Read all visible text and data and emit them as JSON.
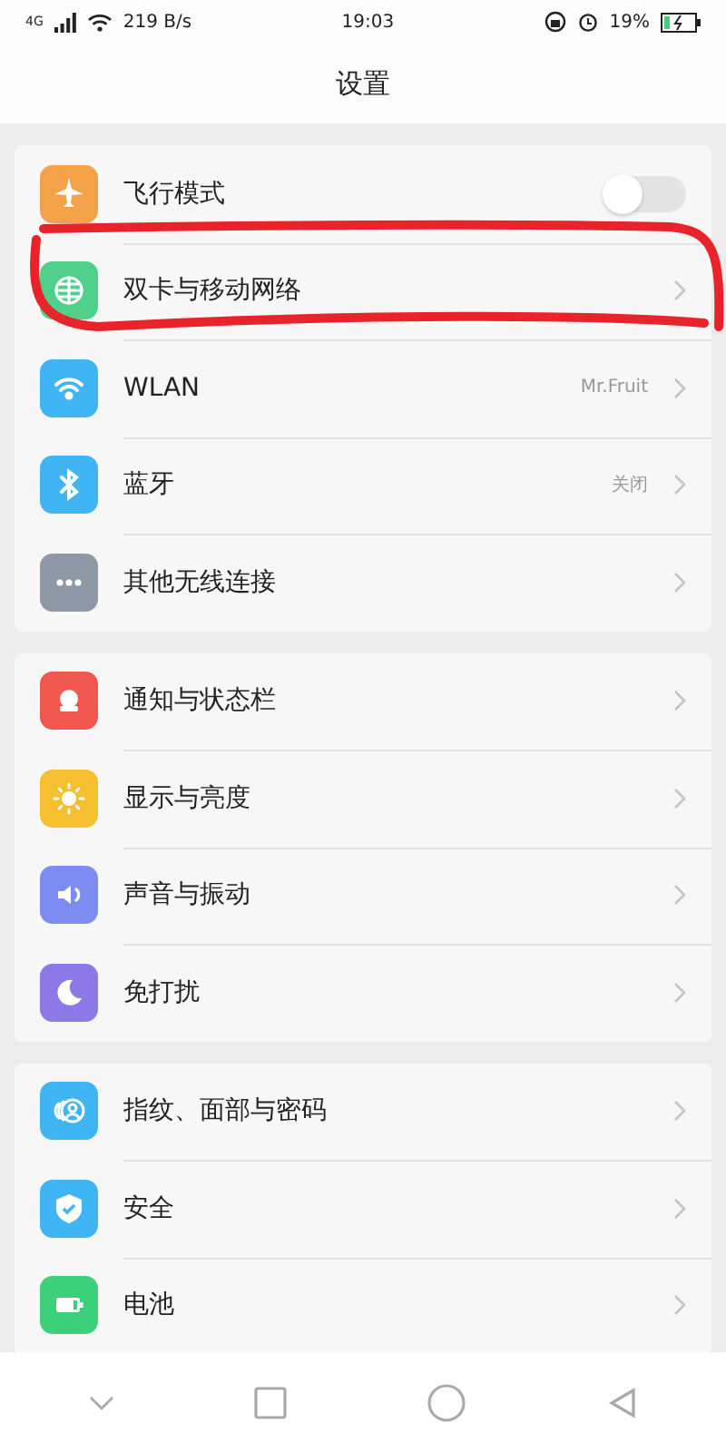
{
  "status_bar": {
    "network": "4G",
    "speed": "219 B/s",
    "time": "19:03",
    "battery": "19%"
  },
  "title": "设置",
  "groups": [
    {
      "items": [
        {
          "label": "飞行模式",
          "kind": "toggle",
          "on": false
        },
        {
          "label": "双卡与移动网络",
          "kind": "link"
        },
        {
          "label": "WLAN",
          "kind": "link",
          "value": "Mr.Fruit"
        },
        {
          "label": "蓝牙",
          "kind": "link",
          "value": "关闭"
        },
        {
          "label": "其他无线连接",
          "kind": "link"
        }
      ]
    },
    {
      "items": [
        {
          "label": "通知与状态栏",
          "kind": "link"
        },
        {
          "label": "显示与亮度",
          "kind": "link"
        },
        {
          "label": "声音与振动",
          "kind": "link"
        },
        {
          "label": "免打扰",
          "kind": "link"
        }
      ]
    },
    {
      "items": [
        {
          "label": "指纹、面部与密码",
          "kind": "link"
        },
        {
          "label": "安全",
          "kind": "link"
        },
        {
          "label": "电池",
          "kind": "link"
        }
      ]
    }
  ]
}
